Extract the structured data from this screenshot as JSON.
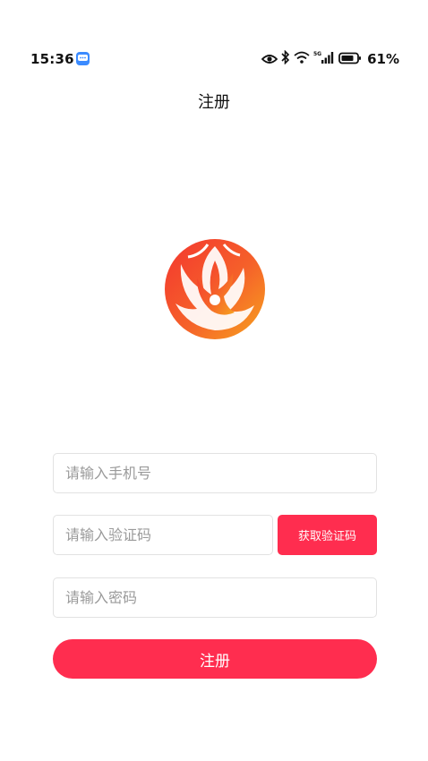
{
  "status_bar": {
    "time": "15:36",
    "battery_percent": "61%",
    "icons": [
      "message-app-icon",
      "eye-icon",
      "bluetooth-icon",
      "wifi-icon",
      "signal-5g-icon",
      "battery-icon"
    ],
    "network_label": "5G"
  },
  "header": {
    "title": "注册"
  },
  "logo": {
    "name": "phoenix-logo",
    "colors": [
      "#f4362f",
      "#f7921e"
    ]
  },
  "form": {
    "phone_placeholder": "请输入手机号",
    "code_placeholder": "请输入验证码",
    "get_code_label": "获取验证码",
    "password_placeholder": "请输入密码",
    "submit_label": "注册"
  },
  "colors": {
    "accent": "#ff2d4f",
    "field_border": "#e2e2e2",
    "placeholder": "#9a9a9a"
  }
}
